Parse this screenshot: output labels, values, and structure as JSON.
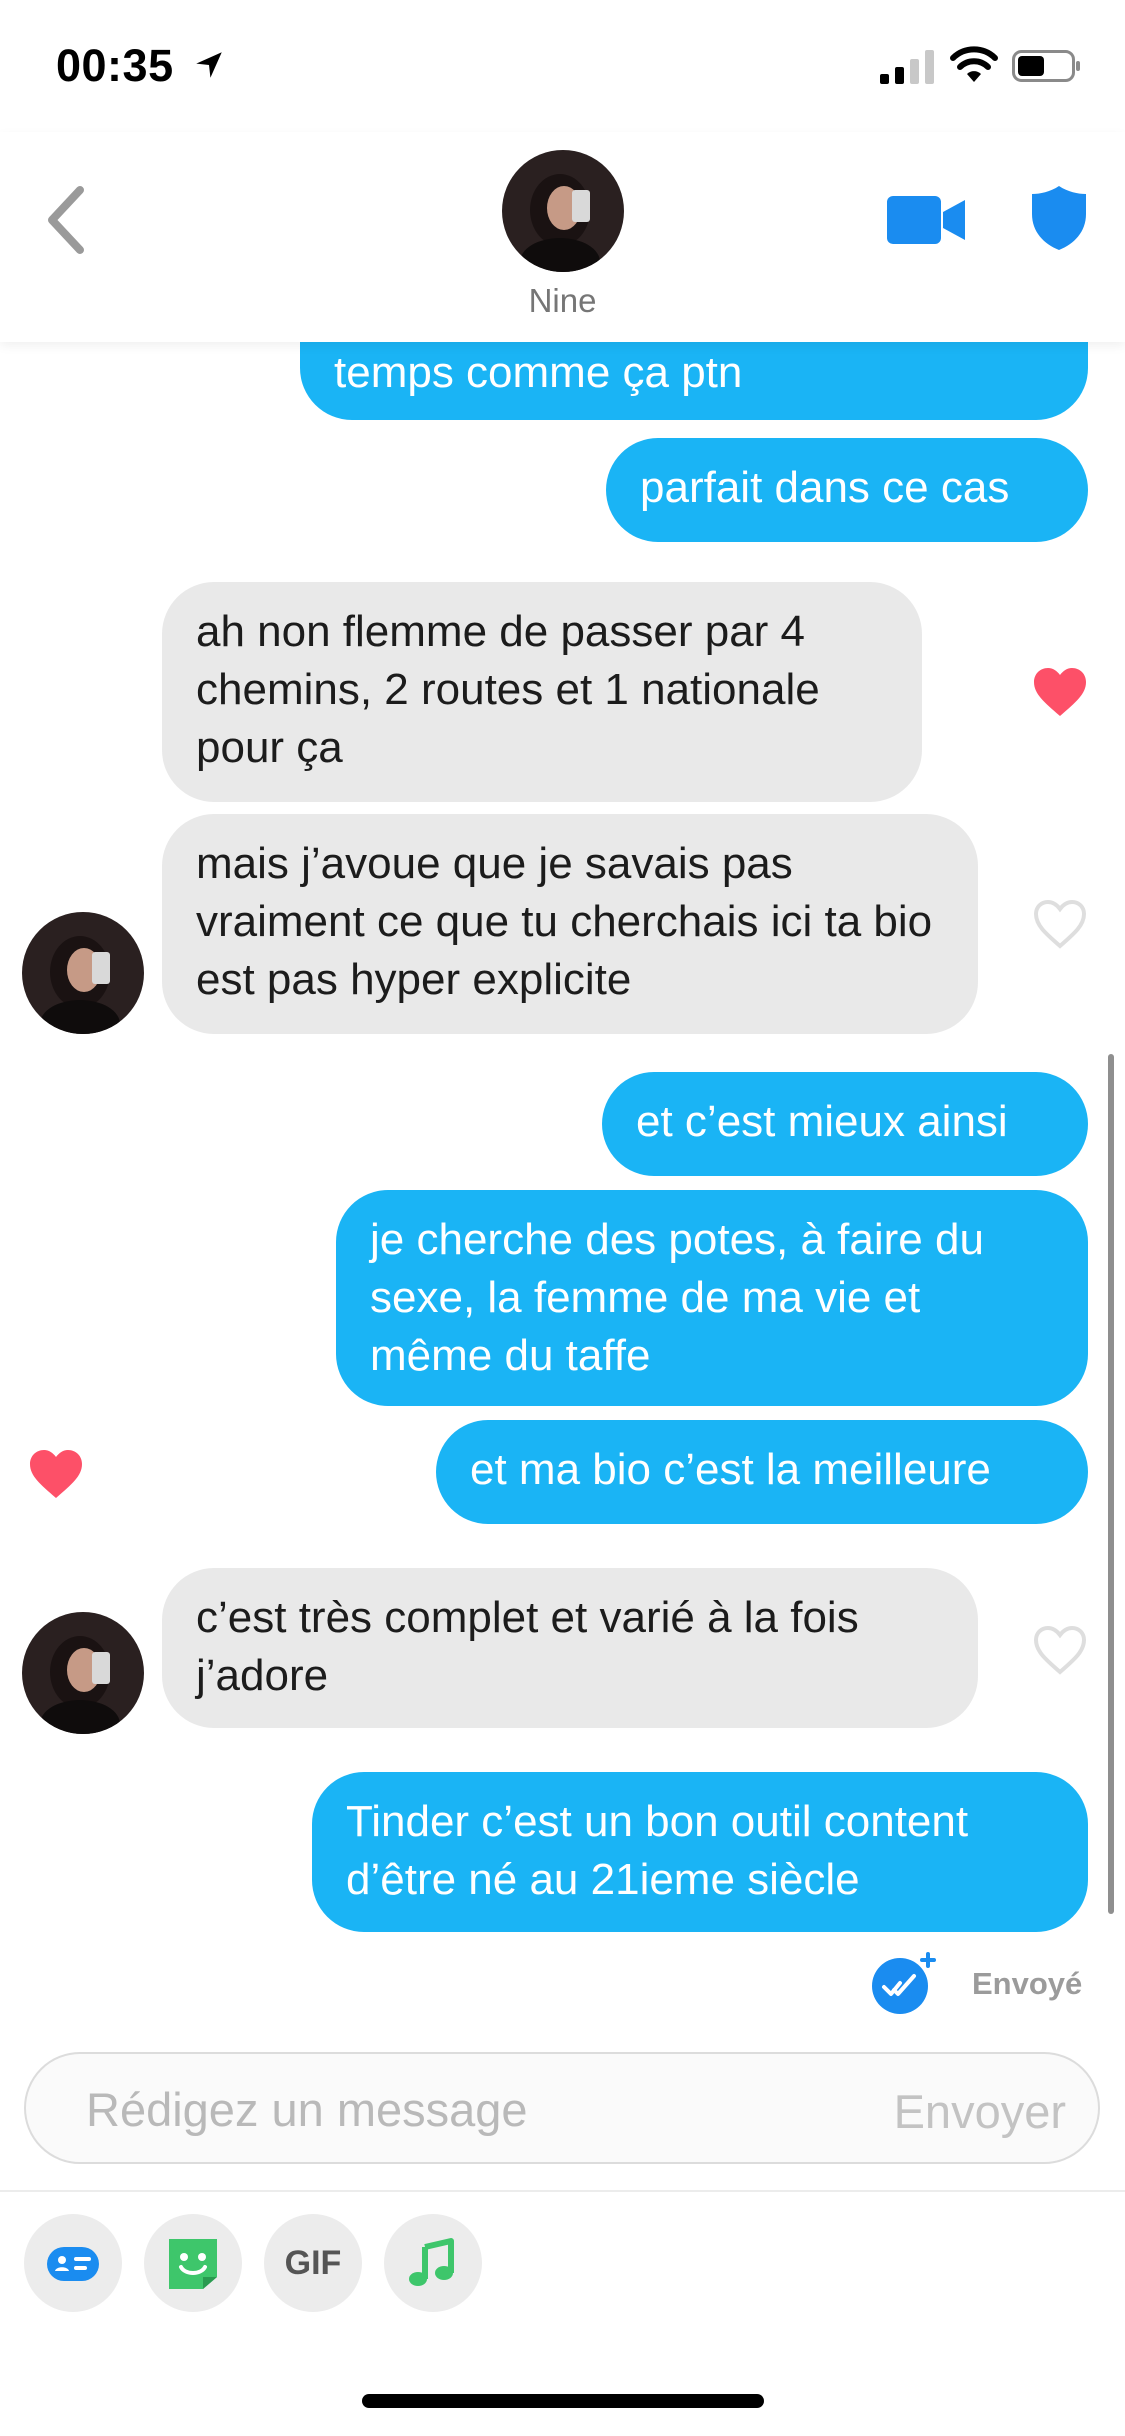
{
  "status_bar": {
    "time": "00:35"
  },
  "header": {
    "contact_name": "Nine"
  },
  "messages": [
    {
      "direction": "out",
      "text": "temps comme ça ptn"
    },
    {
      "direction": "out",
      "text": "parfait dans ce cas"
    },
    {
      "direction": "in",
      "text": "ah non flemme de passer par 4 chemins, 2 routes et 1 nationale pour ça",
      "liked": true
    },
    {
      "direction": "in",
      "text": "mais j’avoue que je savais pas vraiment ce que tu cherchais ici ta bio est pas hyper explicite",
      "liked": false
    },
    {
      "direction": "out",
      "text": "et c’est mieux ainsi"
    },
    {
      "direction": "out",
      "text": "je cherche des potes, à faire du sexe, la femme de ma vie et même du taffe"
    },
    {
      "direction": "out",
      "text": "et ma bio c’est la meilleure",
      "liked": true
    },
    {
      "direction": "in",
      "text": "c’est très complet et varié à la fois j’adore",
      "liked": false
    },
    {
      "direction": "out",
      "text": "Tinder c’est un bon outil content d’être né au 21ieme siècle"
    }
  ],
  "message_status": "Envoyé",
  "composer": {
    "placeholder": "Rédigez un message",
    "send_label": "Envoyer"
  },
  "toolbar": {
    "gif_label": "GIF"
  },
  "colors": {
    "outgoing_bubble": "#1ab4f5",
    "incoming_bubble": "#e9e9e9",
    "accent_blue": "#1a8cf0",
    "heart_red": "#fd5068",
    "sticker_green": "#3ec66b"
  },
  "icons": [
    "location-arrow-icon",
    "signal-icon",
    "wifi-icon",
    "battery-icon",
    "back-chevron-icon",
    "video-camera-icon",
    "shield-icon",
    "heart-icon",
    "check-badge-icon",
    "contact-card-icon",
    "sticker-icon",
    "music-note-icon"
  ]
}
